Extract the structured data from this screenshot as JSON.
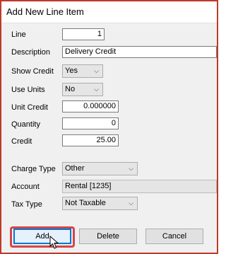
{
  "window": {
    "title": "Add New Line Item"
  },
  "form": {
    "line": {
      "label": "Line",
      "value": "1"
    },
    "description": {
      "label": "Description",
      "value": "Delivery Credit"
    },
    "show_credit": {
      "label": "Show Credit",
      "value": "Yes"
    },
    "use_units": {
      "label": "Use Units",
      "value": "No"
    },
    "unit_credit": {
      "label": "Unit Credit",
      "value": "0.000000"
    },
    "quantity": {
      "label": "Quantity",
      "value": "0"
    },
    "credit": {
      "label": "Credit",
      "value": "25.00"
    },
    "charge_type": {
      "label": "Charge Type",
      "value": "Other"
    },
    "account": {
      "label": "Account",
      "value": "Rental [1235]"
    },
    "tax_type": {
      "label": "Tax Type",
      "value": "Not Taxable"
    }
  },
  "buttons": {
    "add": "Add",
    "delete": "Delete",
    "cancel": "Cancel"
  },
  "icons": {
    "dropdown": "chevron-down-icon",
    "cursor": "mouse-pointer-icon"
  },
  "colors": {
    "highlight": "#d64545",
    "focus": "#0078d7"
  }
}
